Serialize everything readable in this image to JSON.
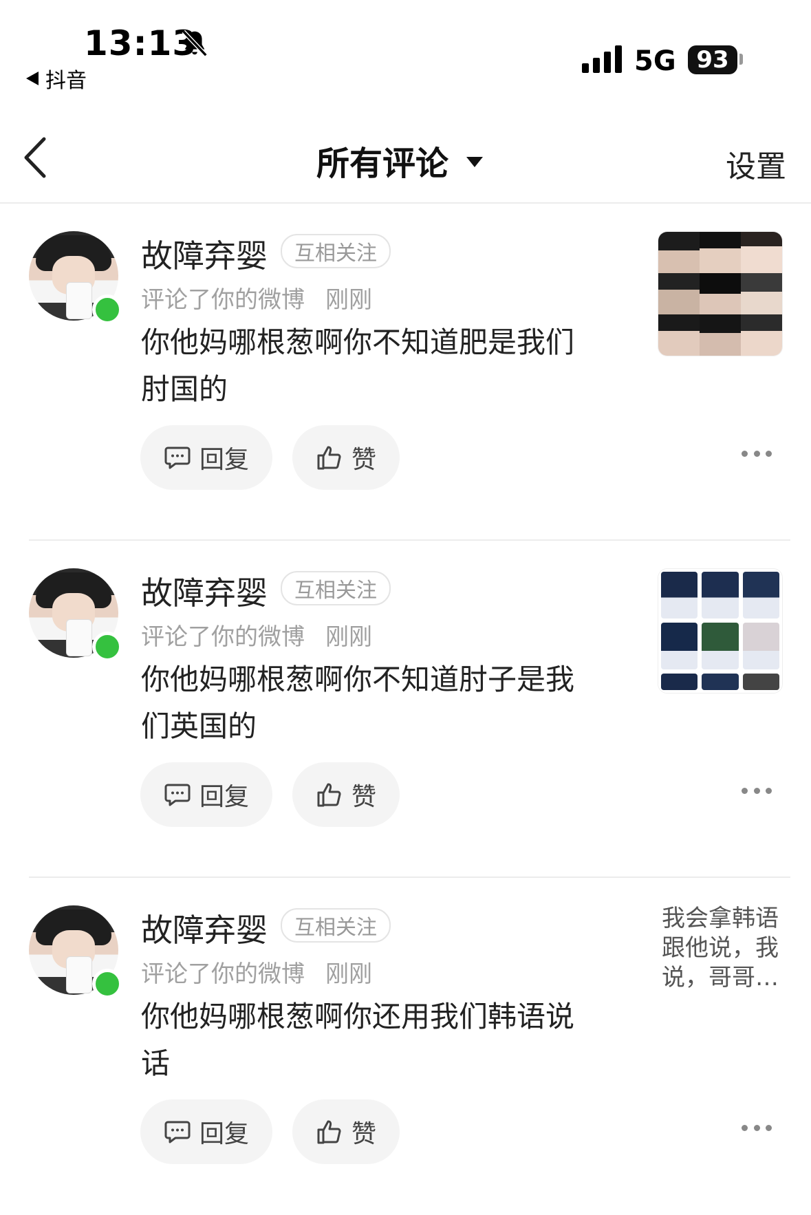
{
  "status_bar": {
    "time": "13:13",
    "back_app": "抖音",
    "network": "5G",
    "battery": "93"
  },
  "nav": {
    "title": "所有评论",
    "settings": "设置"
  },
  "labels": {
    "reply": "回复",
    "like": "赞"
  },
  "comments": [
    {
      "username": "故障弃婴",
      "relation": "互相关注",
      "action": "评论了你的微博",
      "time": "刚刚",
      "text": "你他妈哪根葱啊你不知道肥是我们肘国的",
      "preview_type": "image"
    },
    {
      "username": "故障弃婴",
      "relation": "互相关注",
      "action": "评论了你的微博",
      "time": "刚刚",
      "text": "你他妈哪根葱啊你不知道肘子是我们英国的",
      "preview_type": "image"
    },
    {
      "username": "故障弃婴",
      "relation": "互相关注",
      "action": "评论了你的微博",
      "time": "刚刚",
      "text": "你他妈哪根葱啊你还用我们韩语说话",
      "preview_type": "text",
      "preview_text": "我会拿韩语跟他说，我说，哥哥…"
    }
  ],
  "colors": {
    "online": "#35c13f",
    "button_bg": "#f4f4f4",
    "secondary_text": "#a0a0a0"
  }
}
